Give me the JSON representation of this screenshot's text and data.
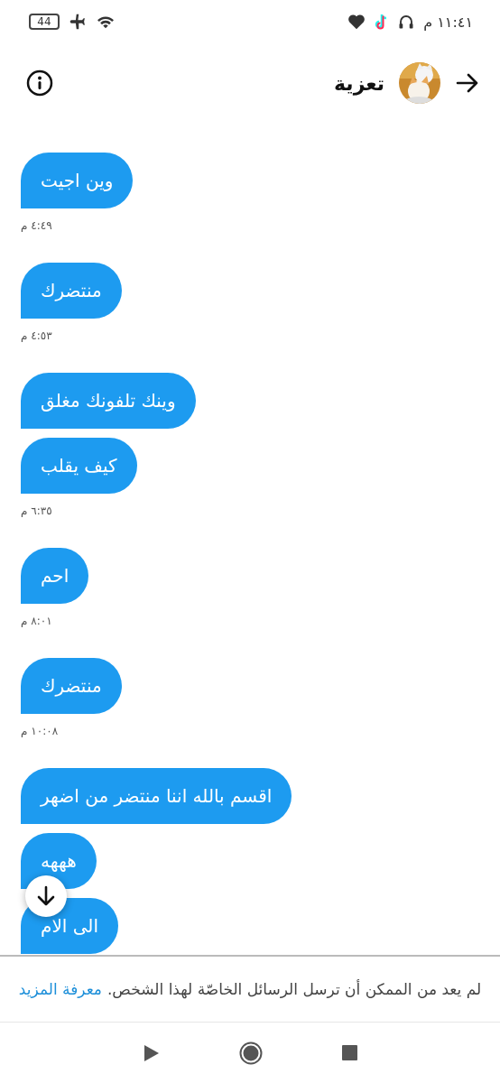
{
  "status_bar": {
    "battery": "44",
    "time": "١١:٤١ م"
  },
  "header": {
    "name": "تعزية"
  },
  "groups": [
    {
      "messages": [
        "وين اجيت"
      ],
      "time": "٤:٤٩ م"
    },
    {
      "messages": [
        "منتضرك"
      ],
      "time": "٤:٥٣ م"
    },
    {
      "messages": [
        "وينك تلفونك مغلق",
        "كيف يقلب"
      ],
      "time": "٦:٣٥ م"
    },
    {
      "messages": [
        "احم"
      ],
      "time": "٨:٠١ م"
    },
    {
      "messages": [
        "منتضرك"
      ],
      "time": "١٠:٠٨ م"
    },
    {
      "messages": [
        "اقسم بالله اننا منتضر من اضهر",
        "هههه",
        "الى الام"
      ]
    }
  ],
  "notice": {
    "text": "لم يعد من الممكن أن ترسل الرسائل الخاصّة لهذا الشخص.",
    "link": "معرفة المزيد"
  }
}
